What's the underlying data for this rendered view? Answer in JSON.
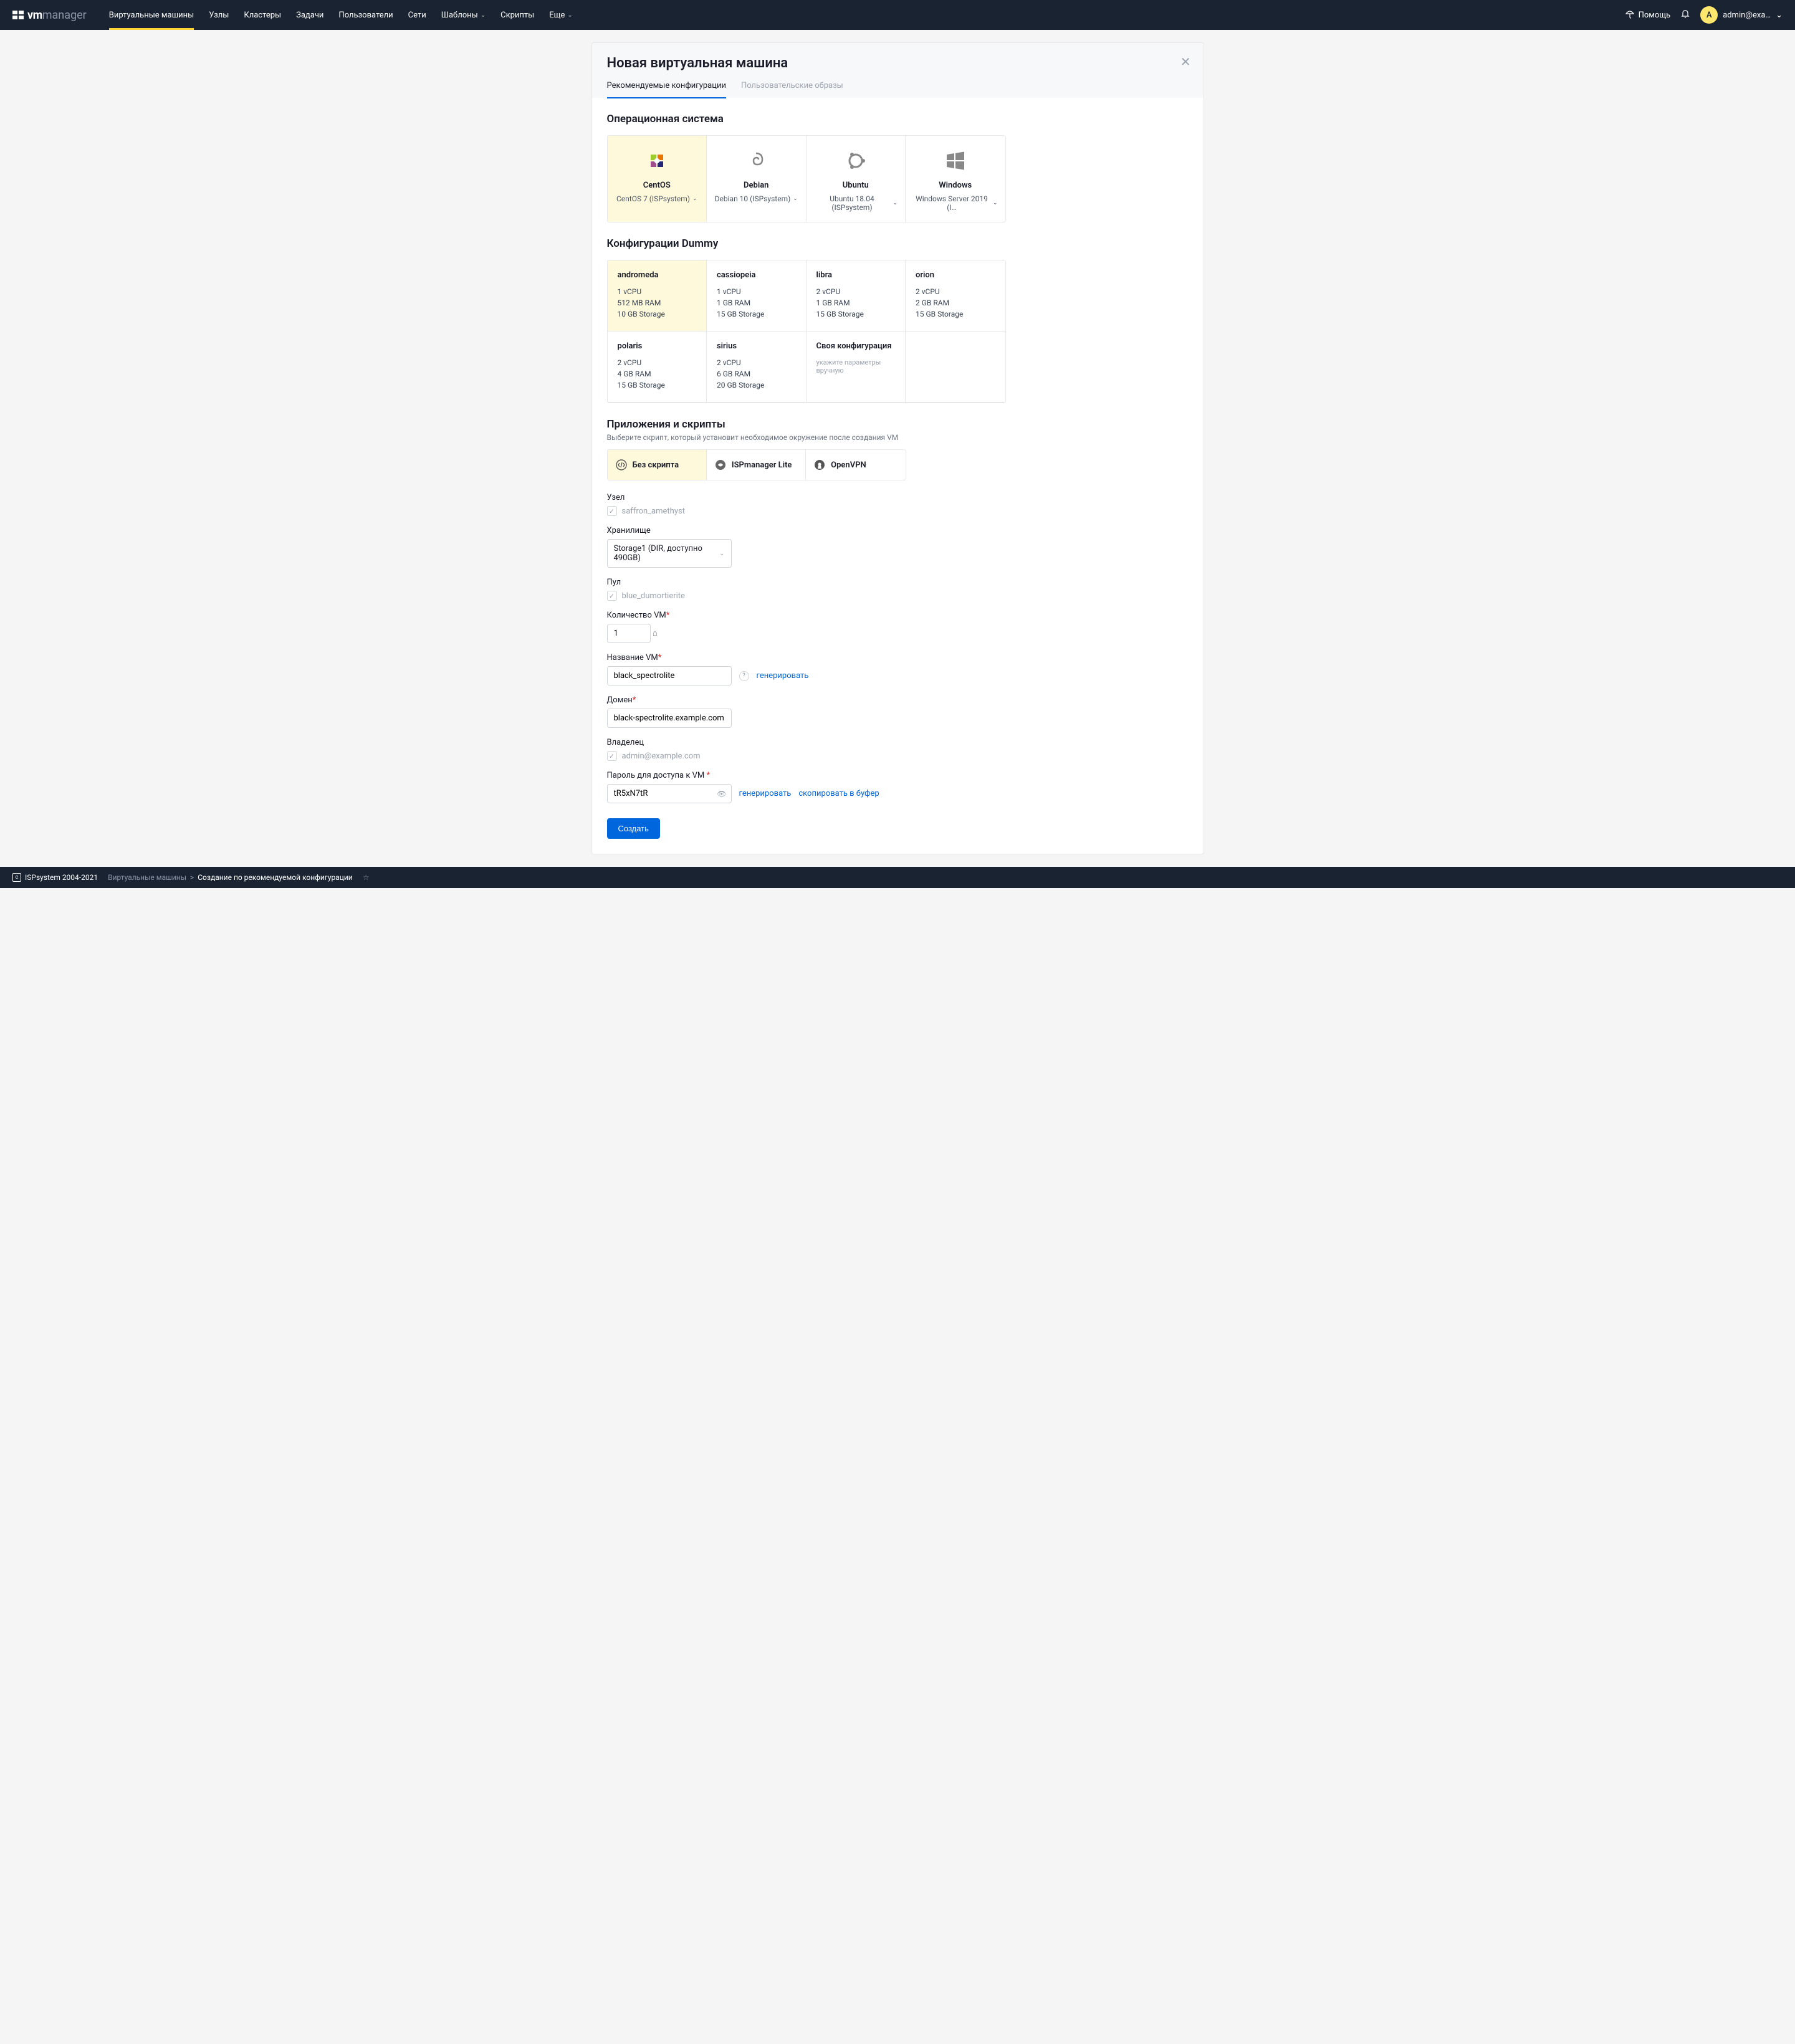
{
  "topbar": {
    "logo_prefix": "vm",
    "logo_suffix": "manager",
    "nav": [
      {
        "label": "Виртуальные машины",
        "active": true
      },
      {
        "label": "Узлы"
      },
      {
        "label": "Кластеры"
      },
      {
        "label": "Задачи"
      },
      {
        "label": "Пользователи"
      },
      {
        "label": "Сети"
      },
      {
        "label": "Шаблоны",
        "dropdown": true
      },
      {
        "label": "Скрипты"
      },
      {
        "label": "Еще",
        "dropdown": true
      }
    ],
    "help": "Помощь",
    "user_initial": "A",
    "user_email": "admin@exa…"
  },
  "page": {
    "title": "Новая виртуальная машина",
    "tabs": [
      {
        "label": "Рекомендуемые конфигурации",
        "active": true
      },
      {
        "label": "Пользовательские образы"
      }
    ]
  },
  "os_section": {
    "title": "Операционная система",
    "items": [
      {
        "name": "CentOS",
        "version": "CentOS 7 (ISPsystem)",
        "selected": true
      },
      {
        "name": "Debian",
        "version": "Debian 10 (ISPsystem)"
      },
      {
        "name": "Ubuntu",
        "version": "Ubuntu 18.04 (ISPsystem)"
      },
      {
        "name": "Windows",
        "version": "Windows Server 2019 (I…"
      }
    ]
  },
  "config_section": {
    "title": "Конфигурации Dummy",
    "items": [
      {
        "name": "andromeda",
        "cpu": "1 vCPU",
        "ram": "512 MB RAM",
        "storage": "10 GB Storage",
        "selected": true
      },
      {
        "name": "cassiopeia",
        "cpu": "1 vCPU",
        "ram": "1 GB RAM",
        "storage": "15 GB Storage"
      },
      {
        "name": "libra",
        "cpu": "2 vCPU",
        "ram": "1 GB RAM",
        "storage": "15 GB Storage"
      },
      {
        "name": "orion",
        "cpu": "2 vCPU",
        "ram": "2 GB RAM",
        "storage": "15 GB Storage"
      },
      {
        "name": "polaris",
        "cpu": "2 vCPU",
        "ram": "4 GB RAM",
        "storage": "15 GB Storage"
      },
      {
        "name": "sirius",
        "cpu": "2 vCPU",
        "ram": "6 GB RAM",
        "storage": "20 GB Storage"
      },
      {
        "name": "Своя конфигурация",
        "hint": "укажите параметры вручную",
        "custom": true
      }
    ]
  },
  "scripts_section": {
    "title": "Приложения и скрипты",
    "subtitle": "Выберите скрипт, который установит необходимое окружение после создания VM",
    "items": [
      {
        "label": "Без скрипта",
        "selected": true,
        "icon": "code"
      },
      {
        "label": "ISPmanager Lite",
        "icon": "isp"
      },
      {
        "label": "OpenVPN",
        "icon": "ovpn"
      }
    ]
  },
  "form": {
    "node_label": "Узел",
    "node_value": "saffron_amethyst",
    "storage_label": "Хранилище",
    "storage_value": "Storage1 (DIR, доступно 490GB)",
    "pool_label": "Пул",
    "pool_value": "blue_dumortierite",
    "count_label": "Количество VM",
    "count_value": "1",
    "name_label": "Название VM",
    "name_value": "black_spectrolite",
    "generate": "генерировать",
    "domain_label": "Домен",
    "domain_value": "black-spectrolite.example.com",
    "owner_label": "Владелец",
    "owner_value": "admin@example.com",
    "password_label": "Пароль для доступа к VM",
    "password_value": "tR5xN7tR",
    "copy_buffer": "скопировать в буфер",
    "submit": "Создать"
  },
  "footer": {
    "copyright": "ISPsystem 2004-2021",
    "crumb1": "Виртуальные машины",
    "crumb2": "Создание по рекомендуемой конфигурации"
  }
}
